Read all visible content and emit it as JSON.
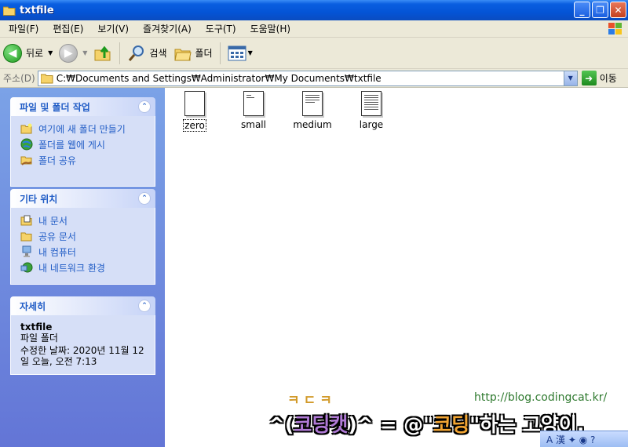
{
  "window": {
    "title": "txtfile"
  },
  "menu": [
    "파일(F)",
    "편집(E)",
    "보기(V)",
    "즐겨찾기(A)",
    "도구(T)",
    "도움말(H)"
  ],
  "toolbar": {
    "back": "뒤로",
    "search": "검색",
    "folders": "폴더"
  },
  "address": {
    "label": "주소(D)",
    "path": "C:₩Documents and Settings₩Administrator₩My Documents₩txtfile",
    "go": "이동"
  },
  "file_tasks": {
    "title": "파일 및 폴더 작업",
    "items": [
      "여기에 새 폴더 만들기",
      "폴더를 웹에 게시",
      "폴더 공유"
    ]
  },
  "other_places": {
    "title": "기타 위치",
    "items": [
      "내 문서",
      "공유 문서",
      "내 컴퓨터",
      "내 네트워크 환경"
    ]
  },
  "details": {
    "title": "자세히",
    "name": "txtfile",
    "type": "파일 폴더",
    "modified_1": "수정한 날짜: 2020년 11월 12",
    "modified_2": "일 오늘, 오전 7:13"
  },
  "files": [
    "zero",
    "small",
    "medium",
    "large"
  ],
  "watermark": {
    "logo_text": "ㅋㄷㅋ",
    "url": "http://blog.codingcat.kr/",
    "part1": "^(",
    "part2": "코딩캣",
    "part3": ")^ = @\"",
    "part4": "코딩",
    "part5": "\"하는 고양이."
  },
  "colors": {
    "title_bar": "#0454d6",
    "left_pane": "#6f8ee0",
    "link": "#215dc6",
    "panel_body": "#d6dff7"
  }
}
